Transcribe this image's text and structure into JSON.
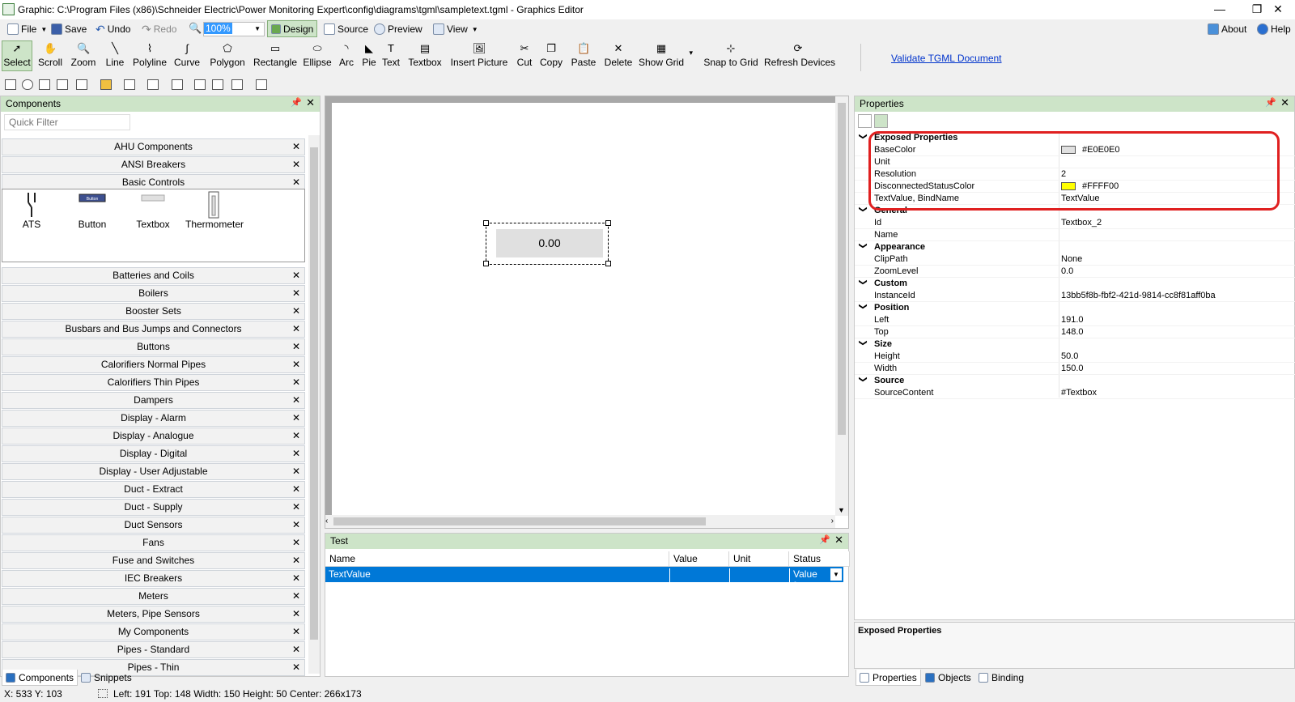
{
  "window": {
    "title": "Graphic: C:\\Program Files (x86)\\Schneider Electric\\Power Monitoring Expert\\config\\diagrams\\tgml\\sampletext.tgml - Graphics Editor",
    "minimize": "—",
    "maximize": "❐",
    "close": "✕"
  },
  "menubar": {
    "file": "File",
    "save": "Save",
    "undo": "Undo",
    "redo": "Redo",
    "zoom_value": "100%",
    "design": "Design",
    "source": "Source",
    "preview": "Preview",
    "view": "View",
    "about": "About",
    "help": "Help"
  },
  "tools": [
    {
      "label": "Select",
      "icon": "cursor-icon"
    },
    {
      "label": "Scroll",
      "icon": "hand-icon"
    },
    {
      "label": "Zoom",
      "icon": "zoom-icon"
    },
    {
      "label": "Line",
      "icon": "line-icon"
    },
    {
      "label": "Polyline",
      "icon": "polyline-icon"
    },
    {
      "label": "Curve",
      "icon": "curve-icon"
    },
    {
      "label": "Polygon",
      "icon": "polygon-icon"
    },
    {
      "label": "Rectangle",
      "icon": "rectangle-icon"
    },
    {
      "label": "Ellipse",
      "icon": "ellipse-icon"
    },
    {
      "label": "Arc",
      "icon": "arc-icon"
    },
    {
      "label": "Pie",
      "icon": "pie-icon"
    },
    {
      "label": "Text",
      "icon": "text-icon"
    },
    {
      "label": "Textbox",
      "icon": "textbox-icon"
    },
    {
      "label": "Insert Picture",
      "icon": "picture-icon"
    },
    {
      "label": "Cut",
      "icon": "cut-icon"
    },
    {
      "label": "Copy",
      "icon": "copy-icon"
    },
    {
      "label": "Paste",
      "icon": "paste-icon"
    },
    {
      "label": "Delete",
      "icon": "delete-icon"
    },
    {
      "label": "Show Grid",
      "icon": "grid-icon"
    },
    {
      "label": "Snap to Grid",
      "icon": "snap-icon"
    },
    {
      "label": "Refresh Devices",
      "icon": "refresh-icon"
    }
  ],
  "validate_link": "Validate TGML Document",
  "components": {
    "title": "Components",
    "quick_filter_placeholder": "Quick Filter",
    "top_categories": [
      "AHU Components",
      "ANSI Breakers",
      "Basic Controls"
    ],
    "basic_items": [
      "ATS",
      "Button",
      "Textbox",
      "Thermometer"
    ],
    "button_caption": "Button",
    "categories": [
      "Batteries and Coils",
      "Boilers",
      "Booster Sets",
      "Busbars and Bus Jumps and Connectors",
      "Buttons",
      "Calorifiers Normal Pipes",
      "Calorifiers Thin Pipes",
      "Dampers",
      "Display - Alarm",
      "Display - Analogue",
      "Display - Digital",
      "Display - User Adjustable",
      "Duct - Extract",
      "Duct - Supply",
      "Duct Sensors",
      "Fans",
      "Fuse and Switches",
      "IEC Breakers",
      "Meters",
      "Meters, Pipe Sensors",
      "My Components",
      "Pipes - Standard",
      "Pipes - Thin"
    ],
    "tab_components": "Components",
    "tab_snippets": "Snippets"
  },
  "canvas": {
    "textbox_value": "0.00"
  },
  "test": {
    "title": "Test",
    "columns": [
      "Name",
      "Value",
      "Unit",
      "Status"
    ],
    "row": {
      "name": "TextValue",
      "value": "",
      "unit": "",
      "status": "Value f..."
    }
  },
  "properties": {
    "title": "Properties",
    "sections": [
      {
        "name": "Exposed Properties",
        "rows": [
          {
            "key": "BaseColor",
            "value": "#E0E0E0",
            "swatch": "#E0E0E0"
          },
          {
            "key": "Unit",
            "value": ""
          },
          {
            "key": "Resolution",
            "value": "2"
          },
          {
            "key": "DisconnectedStatusColor",
            "value": "#FFFF00",
            "swatch": "#FFFF00"
          },
          {
            "key": "TextValue, BindName",
            "value": "TextValue"
          }
        ]
      },
      {
        "name": "General",
        "rows": [
          {
            "key": "Id",
            "value": "Textbox_2"
          },
          {
            "key": "Name",
            "value": ""
          }
        ]
      },
      {
        "name": "Appearance",
        "rows": [
          {
            "key": "ClipPath",
            "value": "None"
          },
          {
            "key": "ZoomLevel",
            "value": "0.0"
          }
        ]
      },
      {
        "name": "Custom",
        "rows": [
          {
            "key": "InstanceId",
            "value": "13bb5f8b-fbf2-421d-9814-cc8f81aff0ba"
          }
        ]
      },
      {
        "name": "Position",
        "rows": [
          {
            "key": "Left",
            "value": "191.0"
          },
          {
            "key": "Top",
            "value": "148.0"
          }
        ]
      },
      {
        "name": "Size",
        "rows": [
          {
            "key": "Height",
            "value": "50.0"
          },
          {
            "key": "Width",
            "value": "150.0"
          }
        ]
      },
      {
        "name": "Source",
        "rows": [
          {
            "key": "SourceContent",
            "value": "#Textbox"
          }
        ]
      }
    ],
    "description_title": "Exposed Properties",
    "tab_properties": "Properties",
    "tab_objects": "Objects",
    "tab_binding": "Binding"
  },
  "status": {
    "cursor": "X: 533  Y: 103",
    "selection": "Left: 191  Top: 148  Width: 150  Height: 50  Center: 266x173"
  }
}
